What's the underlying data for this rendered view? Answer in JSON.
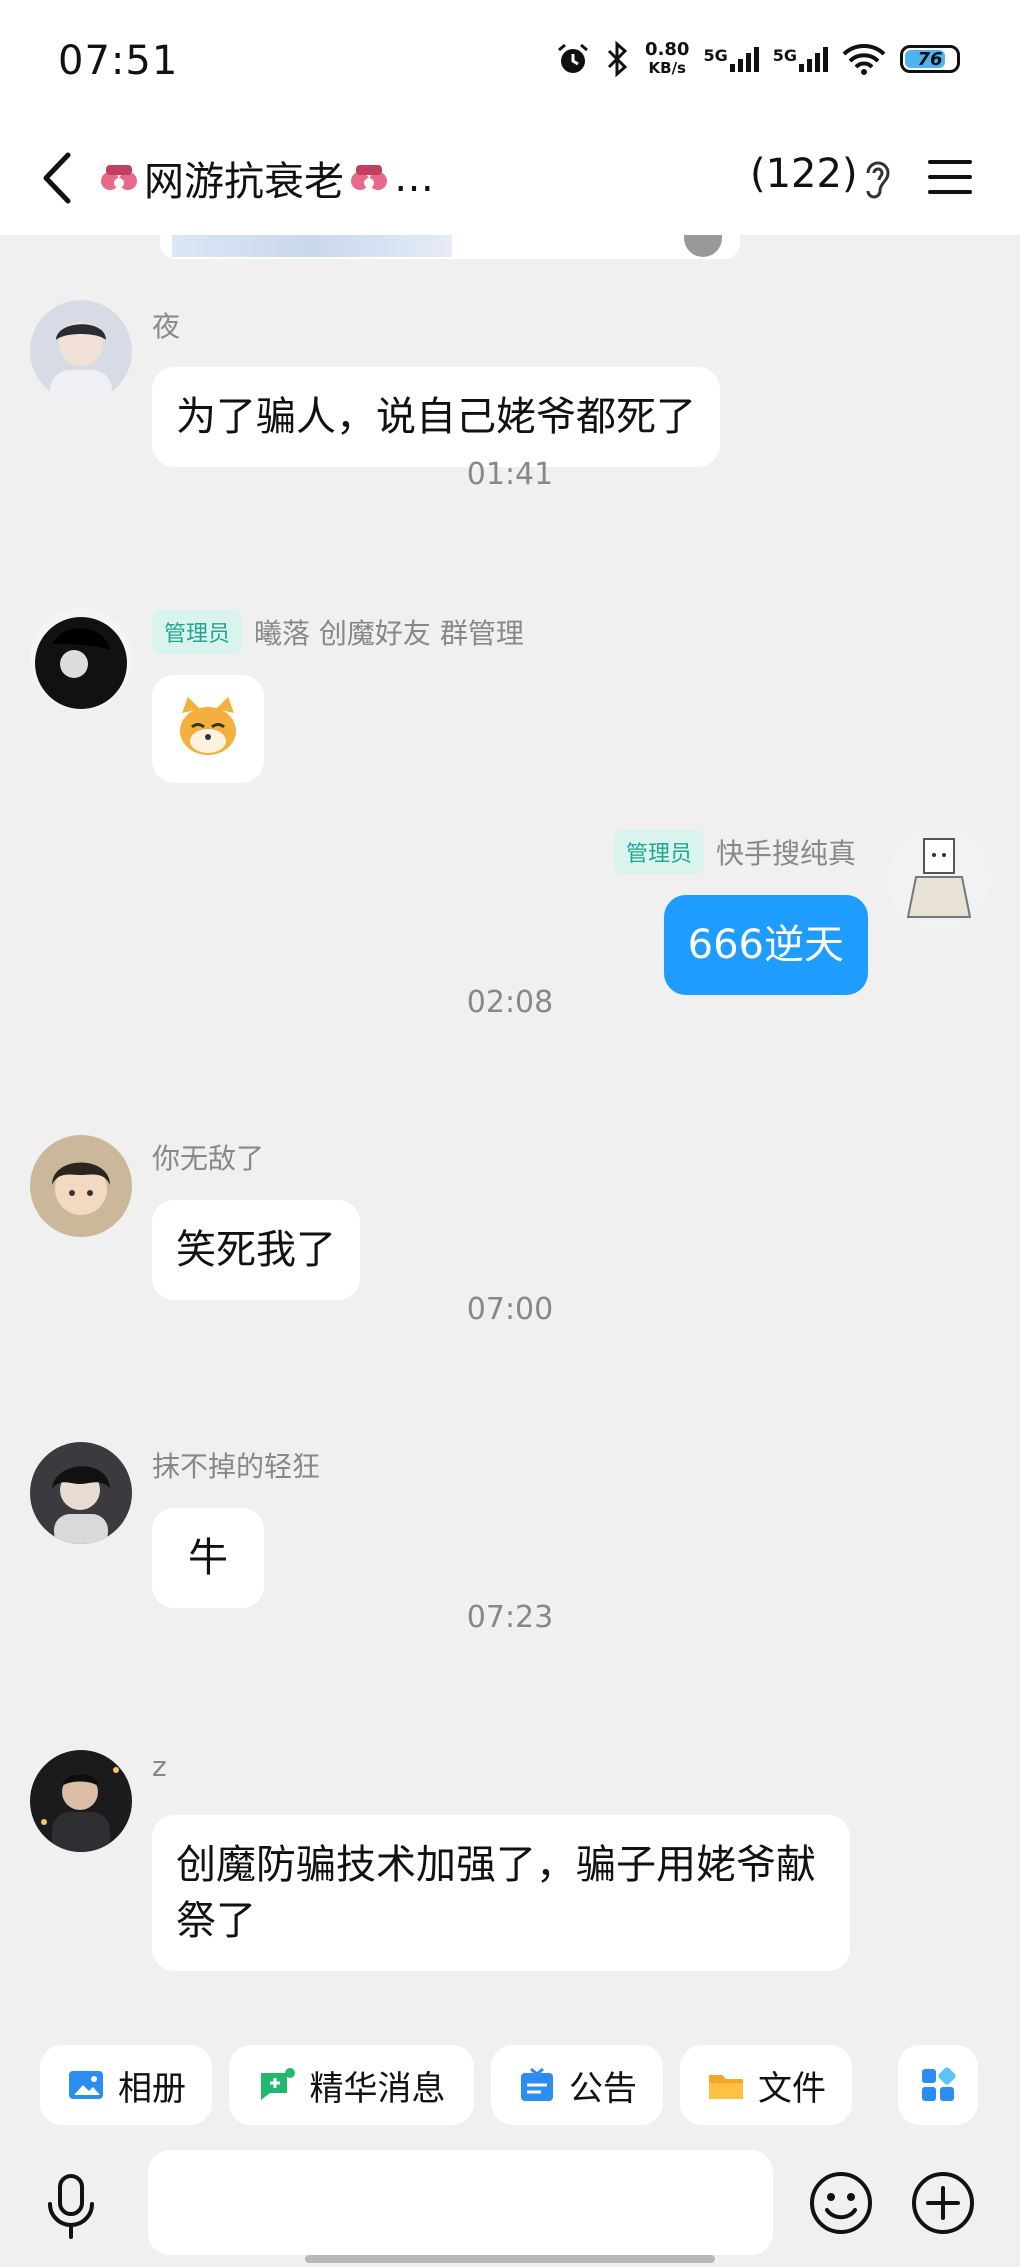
{
  "status_bar": {
    "time": "07:51",
    "net_speed_value": "0.80",
    "net_speed_unit": "KB/s",
    "signal_1": "5G",
    "signal_2": "5G",
    "battery": "76",
    "icons": [
      "alarm-icon",
      "bluetooth-icon",
      "signal-icon",
      "signal-icon",
      "wifi-icon",
      "battery-icon"
    ]
  },
  "header": {
    "title": "网游抗衰老",
    "title_suffix": "…",
    "member_count": "(122)",
    "icons": [
      "back-icon",
      "ear-icon",
      "menu-icon"
    ]
  },
  "colors": {
    "background": "#f0f0f0",
    "my_bubble": "#1e9cff",
    "admin_badge_bg": "#d9f3ee",
    "admin_badge_text": "#21a791"
  },
  "messages": [
    {
      "sender": "夜",
      "text": "为了骗人，说自己姥爷都死了"
    },
    {
      "timestamp": "01:41"
    },
    {
      "badge": "管理员",
      "sender": "曦落 创魔好友 群管理",
      "sticker": "shiba-sticker"
    },
    {
      "badge": "管理员",
      "sender": "快手搜纯真",
      "text": "666逆天",
      "is_me": true
    },
    {
      "timestamp": "02:08"
    },
    {
      "sender": "你无敌了",
      "text": "笑死我了"
    },
    {
      "timestamp": "07:00"
    },
    {
      "sender": "抹不掉的轻狂",
      "text": "牛"
    },
    {
      "timestamp": "07:23"
    },
    {
      "sender": "z",
      "text": "创魔防骗技术加强了，骗子用姥爷献祭了"
    }
  ],
  "toolbar": {
    "items": [
      {
        "label": "相册",
        "icon": "album-icon"
      },
      {
        "label": "精华消息",
        "icon": "essence-icon"
      },
      {
        "label": "公告",
        "icon": "announcement-icon"
      },
      {
        "label": "文件",
        "icon": "folder-icon"
      }
    ],
    "more_icon": "apps-icon"
  },
  "input_bar": {
    "placeholder": "",
    "icons": [
      "mic-icon",
      "emoji-icon",
      "plus-icon"
    ]
  }
}
